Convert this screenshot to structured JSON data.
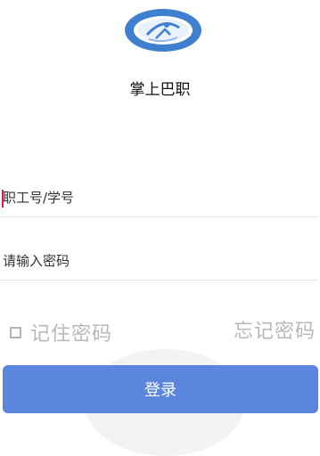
{
  "app": {
    "title": "掌上巴职"
  },
  "form": {
    "username_placeholder": "职工号/学号",
    "password_placeholder": "请输入密码",
    "remember_label": "记住密码",
    "remember_checked": false,
    "forgot_label": "忘记密码",
    "login_label": "登录"
  },
  "colors": {
    "primary": "#5b86dd",
    "logo_blue": "#3f7fd0",
    "muted_text": "#b8b8b8",
    "caret": "#d81b60"
  },
  "icons": {
    "logo": "school-emblem-logo",
    "checkbox": "checkbox-icon"
  }
}
